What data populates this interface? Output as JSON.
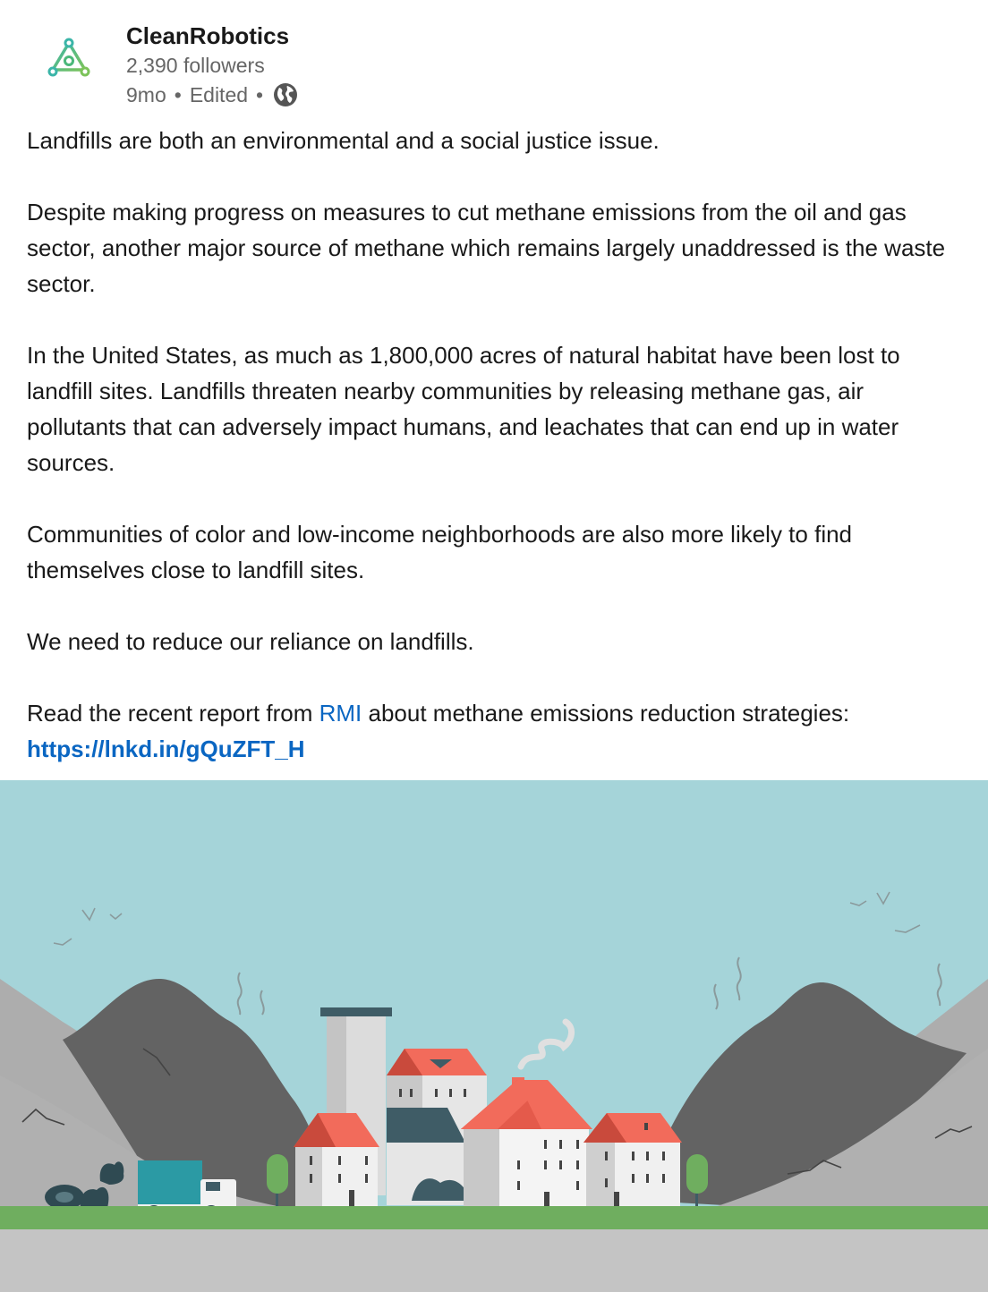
{
  "author": {
    "name": "CleanRobotics",
    "followers": "2,390 followers",
    "time": "9mo",
    "edited": "Edited",
    "separator": "•",
    "visibility_icon": "globe-icon",
    "logo_icon": "cleanrobotics-logo-icon"
  },
  "post": {
    "p1": "Landfills are both an environmental and a social justice issue.",
    "p2": "Despite making progress on measures to cut methane emissions from the oil and gas sector, another major source of methane which remains largely unaddressed is the waste sector.",
    "p3": "In the United States, as much as 1,800,000 acres of natural habitat have been lost to landfill sites. Landfills threaten nearby communities by releasing methane gas, air pollutants that can adversely impact humans, and leachates that can end up in water sources.",
    "p4": "Communities of color and low-income neighborhoods are also more likely to find themselves close to landfill sites.",
    "p5": "We need to reduce our reliance on landfills.",
    "p6_before": "Read the recent report from ",
    "p6_mention": "RMI",
    "p6_middle": " about methane emissions reduction strategies: ",
    "p6_link": "https://lnkd.in/gQuZFT_H"
  },
  "colors": {
    "link": "#0a66c2",
    "sky": "#a5d4d9",
    "grass": "#6fae5f",
    "road": "#c4c4c4",
    "roof": "#f26b5b"
  }
}
